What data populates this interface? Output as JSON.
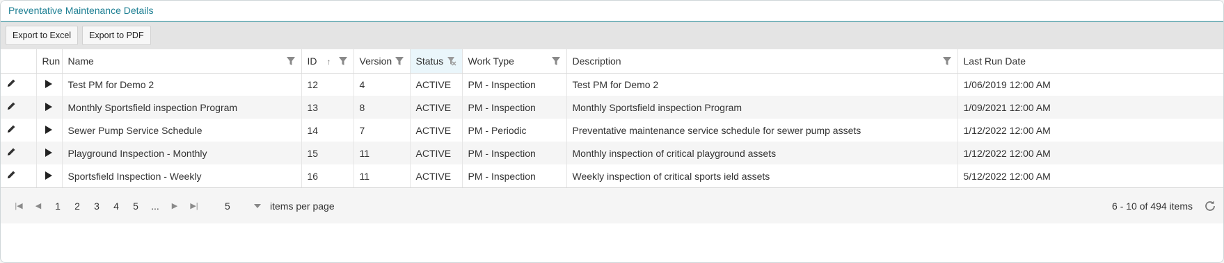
{
  "panel": {
    "title": "Preventative Maintenance Details"
  },
  "toolbar": {
    "export_excel": "Export to Excel",
    "export_pdf": "Export to PDF"
  },
  "columns": {
    "run": "Run",
    "name": "Name",
    "id": "ID",
    "version": "Version",
    "status": "Status",
    "work_type": "Work Type",
    "description": "Description",
    "last_run_date": "Last Run Date"
  },
  "sort_indicator": "↑",
  "rows": [
    {
      "name": "Test PM for Demo 2",
      "id": "12",
      "version": "4",
      "status": "ACTIVE",
      "work_type": "PM - Inspection",
      "description": "Test PM for Demo 2",
      "last_run_date": "1/06/2019 12:00 AM"
    },
    {
      "name": "Monthly Sportsfield inspection Program",
      "id": "13",
      "version": "8",
      "status": "ACTIVE",
      "work_type": "PM - Inspection",
      "description": "Monthly Sportsfield inspection Program",
      "last_run_date": "1/09/2021 12:00 AM"
    },
    {
      "name": "Sewer Pump Service Schedule",
      "id": "14",
      "version": "7",
      "status": "ACTIVE",
      "work_type": "PM - Periodic",
      "description": "Preventative maintenance service schedule for sewer pump assets",
      "last_run_date": "1/12/2022 12:00 AM"
    },
    {
      "name": "Playground Inspection - Monthly",
      "id": "15",
      "version": "11",
      "status": "ACTIVE",
      "work_type": "PM - Inspection",
      "description": "Monthly inspection of critical playground assets",
      "last_run_date": "1/12/2022 12:00 AM"
    },
    {
      "name": "Sportsfield Inspection - Weekly",
      "id": "16",
      "version": "11",
      "status": "ACTIVE",
      "work_type": "PM - Inspection",
      "description": "Weekly inspection of critical sports ield assets",
      "last_run_date": "5/12/2022 12:00 AM"
    }
  ],
  "pager": {
    "pages": [
      "1",
      "2",
      "3",
      "4",
      "5",
      "..."
    ],
    "page_size": "5",
    "items_per_page_label": "items per page",
    "info": "6 - 10 of 494 items"
  },
  "colors": {
    "accent": "#1d7f93",
    "toolbar_bg": "#e4e4e4",
    "status_header_bg": "#eaf6fb"
  }
}
